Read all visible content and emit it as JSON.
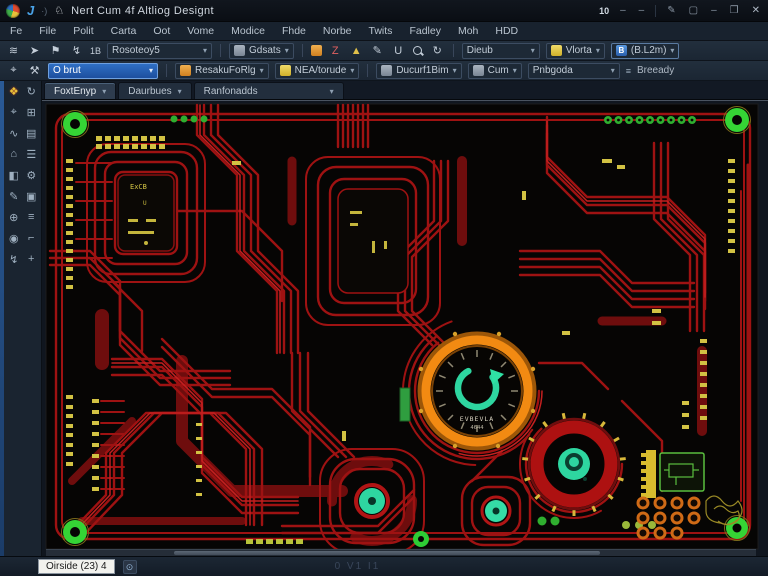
{
  "window": {
    "title": "Nert Cum 4f Altliog Designt",
    "blue_glyph": "J",
    "dim_glyph": "·)",
    "app_icon_glyph": "♘",
    "zoom_level": "10",
    "controls": {
      "pin": "✎",
      "frame": "▢",
      "min": "–",
      "restore": "❐",
      "close": "✕"
    }
  },
  "menubar": {
    "items": [
      "Fe",
      "File",
      "Polit",
      "Carta",
      "Oot",
      "Vome",
      "Modice",
      "Fhde",
      "Norbe",
      "Twits",
      "Fadley",
      "Moh",
      "HDD"
    ]
  },
  "toolbar_primary": {
    "icons": [
      "≋",
      "➤",
      "⚑",
      "↯",
      "1B"
    ],
    "layer_select": "Rosoteoy5",
    "grid_select": "Gdsats",
    "mid_icons": [
      "Z",
      "▲",
      "✎",
      "U",
      "↻"
    ],
    "profile_select": "Dieub",
    "view_select": "Vlorta",
    "scale_select": "(B.L2m)",
    "scale_chip": "B"
  },
  "toolbar_secondary": {
    "icons": [
      "⌖",
      "⚒"
    ],
    "target_value": "O brut",
    "dropdown_1": "ResakuFoRlg",
    "dropdown_2": "NEA/torude",
    "dropdown_3": "Ducurf1Bim",
    "dropdown_4": "Cum",
    "dropdown_5": "Pnbgoda",
    "ready_label": "Breeady"
  },
  "tabs": [
    {
      "label": "FoxtEnyp"
    },
    {
      "label": "Daurbues"
    },
    {
      "label": "Ranfonadds"
    }
  ],
  "sidebar": {
    "icons": [
      {
        "glyph": "❖"
      },
      {
        "glyph": "↻"
      },
      {
        "glyph": "⌖"
      },
      {
        "glyph": "⊞"
      },
      {
        "glyph": "∿"
      },
      {
        "glyph": "▤"
      },
      {
        "glyph": "⌂"
      },
      {
        "glyph": "☰"
      },
      {
        "glyph": "◧"
      },
      {
        "glyph": "⚙"
      },
      {
        "glyph": "✎"
      },
      {
        "glyph": "▣"
      },
      {
        "glyph": "⊕"
      },
      {
        "glyph": "≡"
      },
      {
        "glyph": "◉"
      },
      {
        "glyph": "⌐"
      },
      {
        "glyph": "↯"
      },
      {
        "glyph": "+"
      }
    ]
  },
  "statusbar": {
    "readout": "Oirside (23) 4",
    "icon_glyph": "⊙",
    "hint": "0 V1 I1"
  },
  "pcb": {
    "silkscreen": {
      "ic_label": "ExCB",
      "ic_pin": "U",
      "hub_name": "EVBEVLA",
      "hub_code": "4644"
    },
    "colors": {
      "trace": "#9e1212",
      "trace_dark": "#6e0d0d",
      "trace_bright": "#c42020",
      "pad_yellow": "#d2c243",
      "pad_green": "#35d435",
      "pad_teal": "#2ed6a0",
      "hub_orange": "#f28a12",
      "encoder_red": "#ad1111",
      "via_copper": "#cf6a16",
      "silk_olive": "#9a8a26"
    }
  }
}
